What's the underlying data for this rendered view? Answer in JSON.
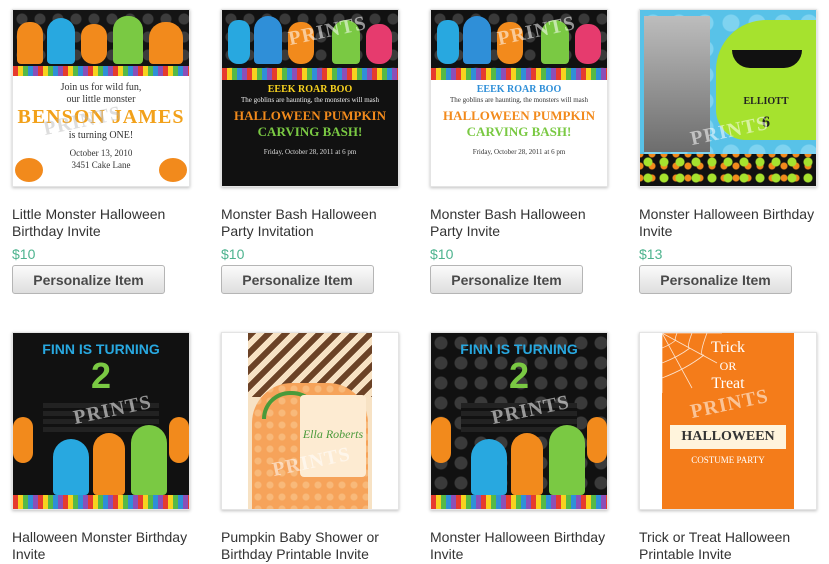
{
  "products": [
    {
      "title": "Little Monster Halloween Birthday Invite",
      "price": "$10",
      "button": "Personalize Item",
      "art": {
        "lines": [
          "Join us for wild fun,",
          "our little monster",
          "BENSON JAMES",
          "is turning ONE!",
          "October 13, 2010",
          "3451 Cake Lane"
        ],
        "watermark": "PRINTS"
      }
    },
    {
      "title": "Monster Bash Halloween Party Invitation",
      "price": "$10",
      "button": "Personalize Item",
      "art": {
        "lines": [
          "EEEK ROAR BOO",
          "The goblins are haunting, the monsters will mash",
          "HALLOWEEN PUMPKIN",
          "CARVING BASH!",
          "Friday, October 28, 2011 at 6 pm"
        ],
        "watermark": "PRINTS"
      }
    },
    {
      "title": "Monster Bash Halloween Party Invite",
      "price": "$10",
      "button": "Personalize Item",
      "art": {
        "lines": [
          "EEEK ROAR BOO",
          "The goblins are haunting, the monsters will mash",
          "HALLOWEEN PUMPKIN",
          "CARVING BASH!",
          "Friday, October 28, 2011 at 6 pm"
        ],
        "watermark": "PRINTS"
      }
    },
    {
      "title": "Monster Halloween Birthday Invite",
      "price": "$13",
      "button": "Personalize Item",
      "art": {
        "lines": [
          "ELLIOTT",
          "6"
        ],
        "watermark": "PRINTS"
      }
    },
    {
      "title": "Halloween Monster Birthday Invite",
      "art": {
        "lines": [
          "FINN IS TURNING",
          "2"
        ],
        "watermark": "PRINTS"
      }
    },
    {
      "title": "Pumpkin Baby Shower or Birthday Printable Invite",
      "art": {
        "lines": [
          "Ella Roberts"
        ],
        "watermark": "PRINTS"
      }
    },
    {
      "title": "Monster Halloween Birthday Invite",
      "art": {
        "lines": [
          "FINN IS TURNING",
          "2"
        ],
        "watermark": "PRINTS"
      }
    },
    {
      "title": "Trick or Treat Halloween Printable Invite",
      "art": {
        "lines": [
          "Trick",
          "OR",
          "Treat",
          "HALLOWEEN",
          "COSTUME PARTY"
        ],
        "watermark": "PRINTS"
      }
    }
  ]
}
